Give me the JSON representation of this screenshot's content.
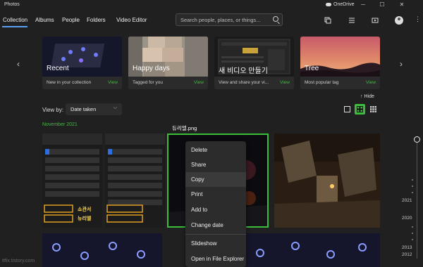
{
  "window": {
    "title": "Photos",
    "onedrive_label": "OneDrive",
    "min_glyph": "─",
    "max_glyph": "☐",
    "close_glyph": "✕"
  },
  "nav": {
    "items": [
      "Collection",
      "Albums",
      "People",
      "Folders",
      "Video Editor"
    ],
    "active": "Collection"
  },
  "search": {
    "placeholder": "Search people, places, or things..."
  },
  "more_glyph": "⋮",
  "carousel": {
    "prev_glyph": "‹",
    "next_glyph": "›",
    "cards": [
      {
        "title": "Recent",
        "description": "New in your collection",
        "action": "View"
      },
      {
        "title": "Happy days",
        "description": "Tagged for you",
        "action": "View"
      },
      {
        "title": "새 비디오 만들기",
        "description": "View and share your vi...",
        "action": "View"
      },
      {
        "title": "Tree",
        "description": "Most popular tag",
        "action": "View"
      }
    ]
  },
  "hide_label": "Hide",
  "hide_glyph": "↑",
  "view_by": {
    "label": "View by:",
    "selected": "Date taken",
    "chevron": "⌵"
  },
  "section_month": "November 2021",
  "selected_photo_name": "듀리엘.png",
  "photo_overlay_text": {
    "line1": "쇼관서",
    "line2": "뉴리엘"
  },
  "context_menu": {
    "items": [
      "Delete",
      "Share",
      "Copy",
      "Print",
      "Add to",
      "Change date",
      "Slideshow",
      "Open in File Explorer"
    ],
    "highlighted": "Copy"
  },
  "timeline": {
    "years": [
      "2021",
      "2020",
      "2013",
      "2012"
    ]
  },
  "watermark": "ttfix.tistory.com",
  "colors": {
    "accent_green": "#3bbf3b",
    "background": "#202020",
    "nav_underline": "#5aa0f0"
  }
}
